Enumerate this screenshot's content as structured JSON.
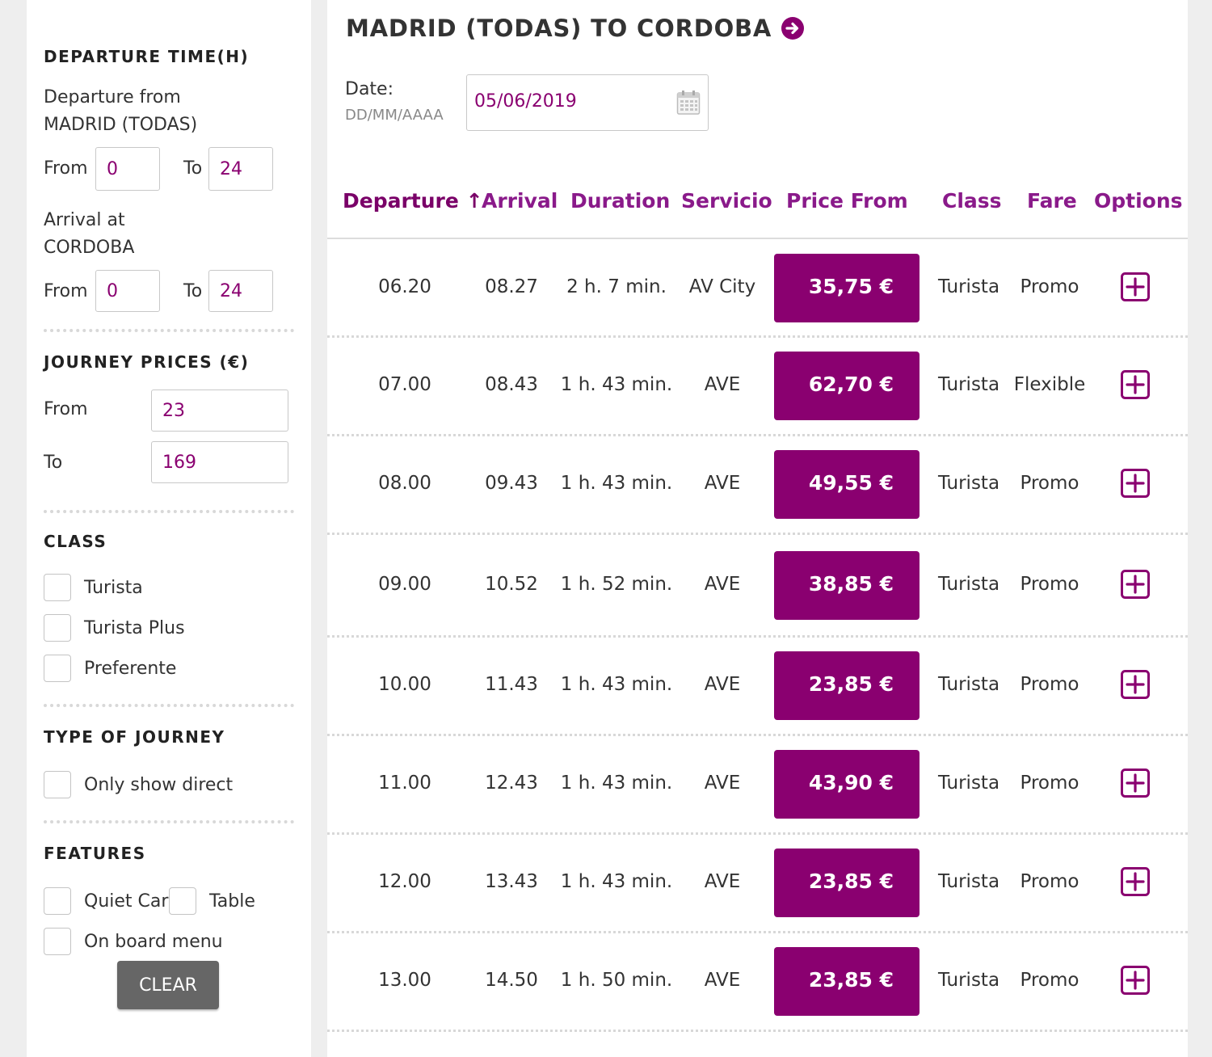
{
  "sidebar": {
    "departure": {
      "title": "DEPARTURE TIME(H)",
      "from_label_1": "Departure from",
      "from_label_2": "MADRID (TODAS)",
      "from_text": "From",
      "from_value": "0",
      "to_text": "To",
      "to_value": "24"
    },
    "arrival": {
      "label_1": "Arrival at",
      "label_2": "CORDOBA",
      "from_text": "From",
      "from_value": "0",
      "to_text": "To",
      "to_value": "24"
    },
    "prices": {
      "title": "JOURNEY PRICES (€)",
      "from_text": "From",
      "from_value": "23",
      "to_text": "To",
      "to_value": "169"
    },
    "class": {
      "title": "CLASS",
      "options": [
        "Turista",
        "Turista Plus",
        "Preferente"
      ]
    },
    "journey": {
      "title": "TYPE OF JOURNEY",
      "option": "Only show direct"
    },
    "features": {
      "title": "FEATURES",
      "options": [
        "Quiet Car",
        "Table",
        "On board menu"
      ]
    },
    "clear_label": "CLEAR"
  },
  "main": {
    "title": "MADRID (TODAS) TO CORDOBA",
    "date_label": "Date:",
    "date_hint": "DD/MM/AAAA",
    "date_value": "05/06/2019",
    "columns": {
      "departure": "Departure",
      "sort_arrow": "↑",
      "arrival": "Arrival",
      "duration": "Duration",
      "servicio": "Servicio",
      "price_from": "Price From",
      "class": "Class",
      "fare": "Fare",
      "options": "Options"
    },
    "rows": [
      {
        "departure": "06.20",
        "arrival": "08.27",
        "duration": "2 h. 7 min.",
        "servicio": "AV City",
        "price": "35,75 €",
        "class": "Turista",
        "fare": "Promo"
      },
      {
        "departure": "07.00",
        "arrival": "08.43",
        "duration": "1 h. 43 min.",
        "servicio": "AVE",
        "price": "62,70 €",
        "class": "Turista",
        "fare": "Flexible"
      },
      {
        "departure": "08.00",
        "arrival": "09.43",
        "duration": "1 h. 43 min.",
        "servicio": "AVE",
        "price": "49,55 €",
        "class": "Turista",
        "fare": "Promo"
      },
      {
        "departure": "09.00",
        "arrival": "10.52",
        "duration": "1 h. 52 min.",
        "servicio": "AVE",
        "price": "38,85 €",
        "class": "Turista",
        "fare": "Promo"
      },
      {
        "departure": "10.00",
        "arrival": "11.43",
        "duration": "1 h. 43 min.",
        "servicio": "AVE",
        "price": "23,85 €",
        "class": "Turista",
        "fare": "Promo"
      },
      {
        "departure": "11.00",
        "arrival": "12.43",
        "duration": "1 h. 43 min.",
        "servicio": "AVE",
        "price": "43,90 €",
        "class": "Turista",
        "fare": "Promo"
      },
      {
        "departure": "12.00",
        "arrival": "13.43",
        "duration": "1 h. 43 min.",
        "servicio": "AVE",
        "price": "23,85 €",
        "class": "Turista",
        "fare": "Promo"
      },
      {
        "departure": "13.00",
        "arrival": "14.50",
        "duration": "1 h. 50 min.",
        "servicio": "AVE",
        "price": "23,85 €",
        "class": "Turista",
        "fare": "Promo"
      }
    ]
  },
  "colors": {
    "accent": "#8a0070",
    "heading_purple": "#8a1a8a",
    "clear_button": "#666666"
  },
  "icons": {
    "title_arrow": "arrow-right-circle-icon",
    "date": "calendar-icon",
    "option": "plus-square-icon"
  }
}
